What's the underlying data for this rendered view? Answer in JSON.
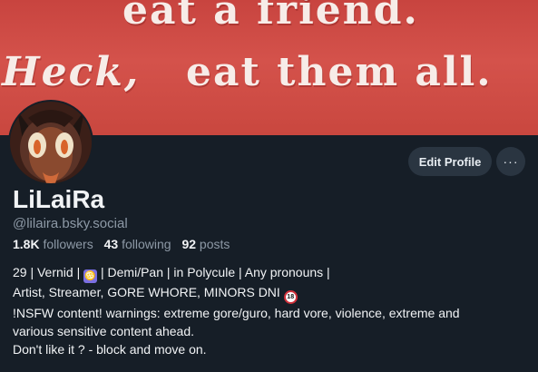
{
  "banner": {
    "line1": "eat a friend.",
    "line2a": "Heck,",
    "line2b": "eat them all."
  },
  "profile": {
    "display_name": "LiLaiRa",
    "handle": "@lilaira.bsky.social",
    "followers_count": "1.8K",
    "followers_label": "followers",
    "following_count": "43",
    "following_label": "following",
    "posts_count": "92",
    "posts_label": "posts"
  },
  "actions": {
    "edit_label": "Edit Profile",
    "more_label": "···"
  },
  "bio": {
    "line1_a": "29 | Vernid | ",
    "line1_icon": "♋",
    "line1_b": " | Demi/Pan | in Polycule | Any pronouns |",
    "line2": "Artist, Streamer, GORE WHORE, MINORS DNI ",
    "line2_badge": "18",
    "line3": "!NSFW content! warnings: extreme gore/guro, hard vore, violence, extreme and",
    "line4": "various sensitive content ahead.",
    "line5": "Don't like it ? - block and move on."
  },
  "icons": {
    "avatar": "avatar-icon",
    "zodiac": "cancer-zodiac-icon",
    "age_restriction": "no-under-18-icon",
    "more": "ellipsis-icon"
  },
  "colors": {
    "background": "#161e27",
    "banner": "#c8443f",
    "button": "#2a3541",
    "muted_text": "#8d99a6"
  }
}
